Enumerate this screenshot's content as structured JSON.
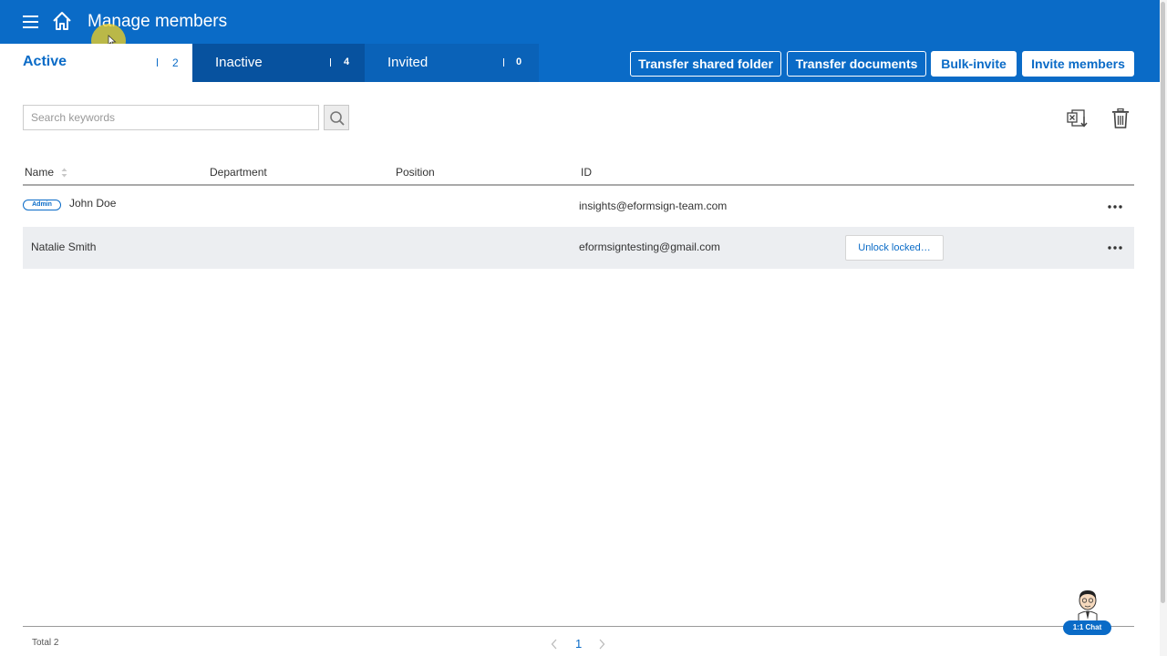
{
  "header": {
    "title": "Manage members",
    "bg_color": "#0a6bc7"
  },
  "tabs": [
    {
      "label": "Active",
      "count": "2",
      "selected": true
    },
    {
      "label": "Inactive",
      "count": "4",
      "selected": false
    },
    {
      "label": "Invited",
      "count": "0",
      "selected": false
    }
  ],
  "actions": {
    "transfer_shared_folder": "Transfer shared folder",
    "transfer_documents": "Transfer documents",
    "bulk_invite": "Bulk-invite",
    "invite_members": "Invite members"
  },
  "search": {
    "placeholder": "Search keywords",
    "value": ""
  },
  "table": {
    "columns": [
      "Name",
      "Department",
      "Position",
      "ID"
    ],
    "rows": [
      {
        "badge": "Admin",
        "name": "John Doe",
        "department": "",
        "position": "",
        "id": "insights@eformsign-team.com",
        "action": ""
      },
      {
        "badge": "",
        "name": "Natalie Smith",
        "department": "",
        "position": "",
        "id": "eformsigntesting@gmail.com",
        "action": "Unlock locked…"
      }
    ]
  },
  "footer": {
    "total": "Total 2",
    "current_page": "1"
  },
  "chat": {
    "label": "1:1 Chat"
  },
  "icons": {
    "menu": "hamburger-menu-icon",
    "home": "home-icon",
    "search": "search-icon",
    "excel": "excel-download-icon",
    "trash": "trash-icon",
    "more": "more-dots-icon",
    "sort": "sort-icon"
  }
}
